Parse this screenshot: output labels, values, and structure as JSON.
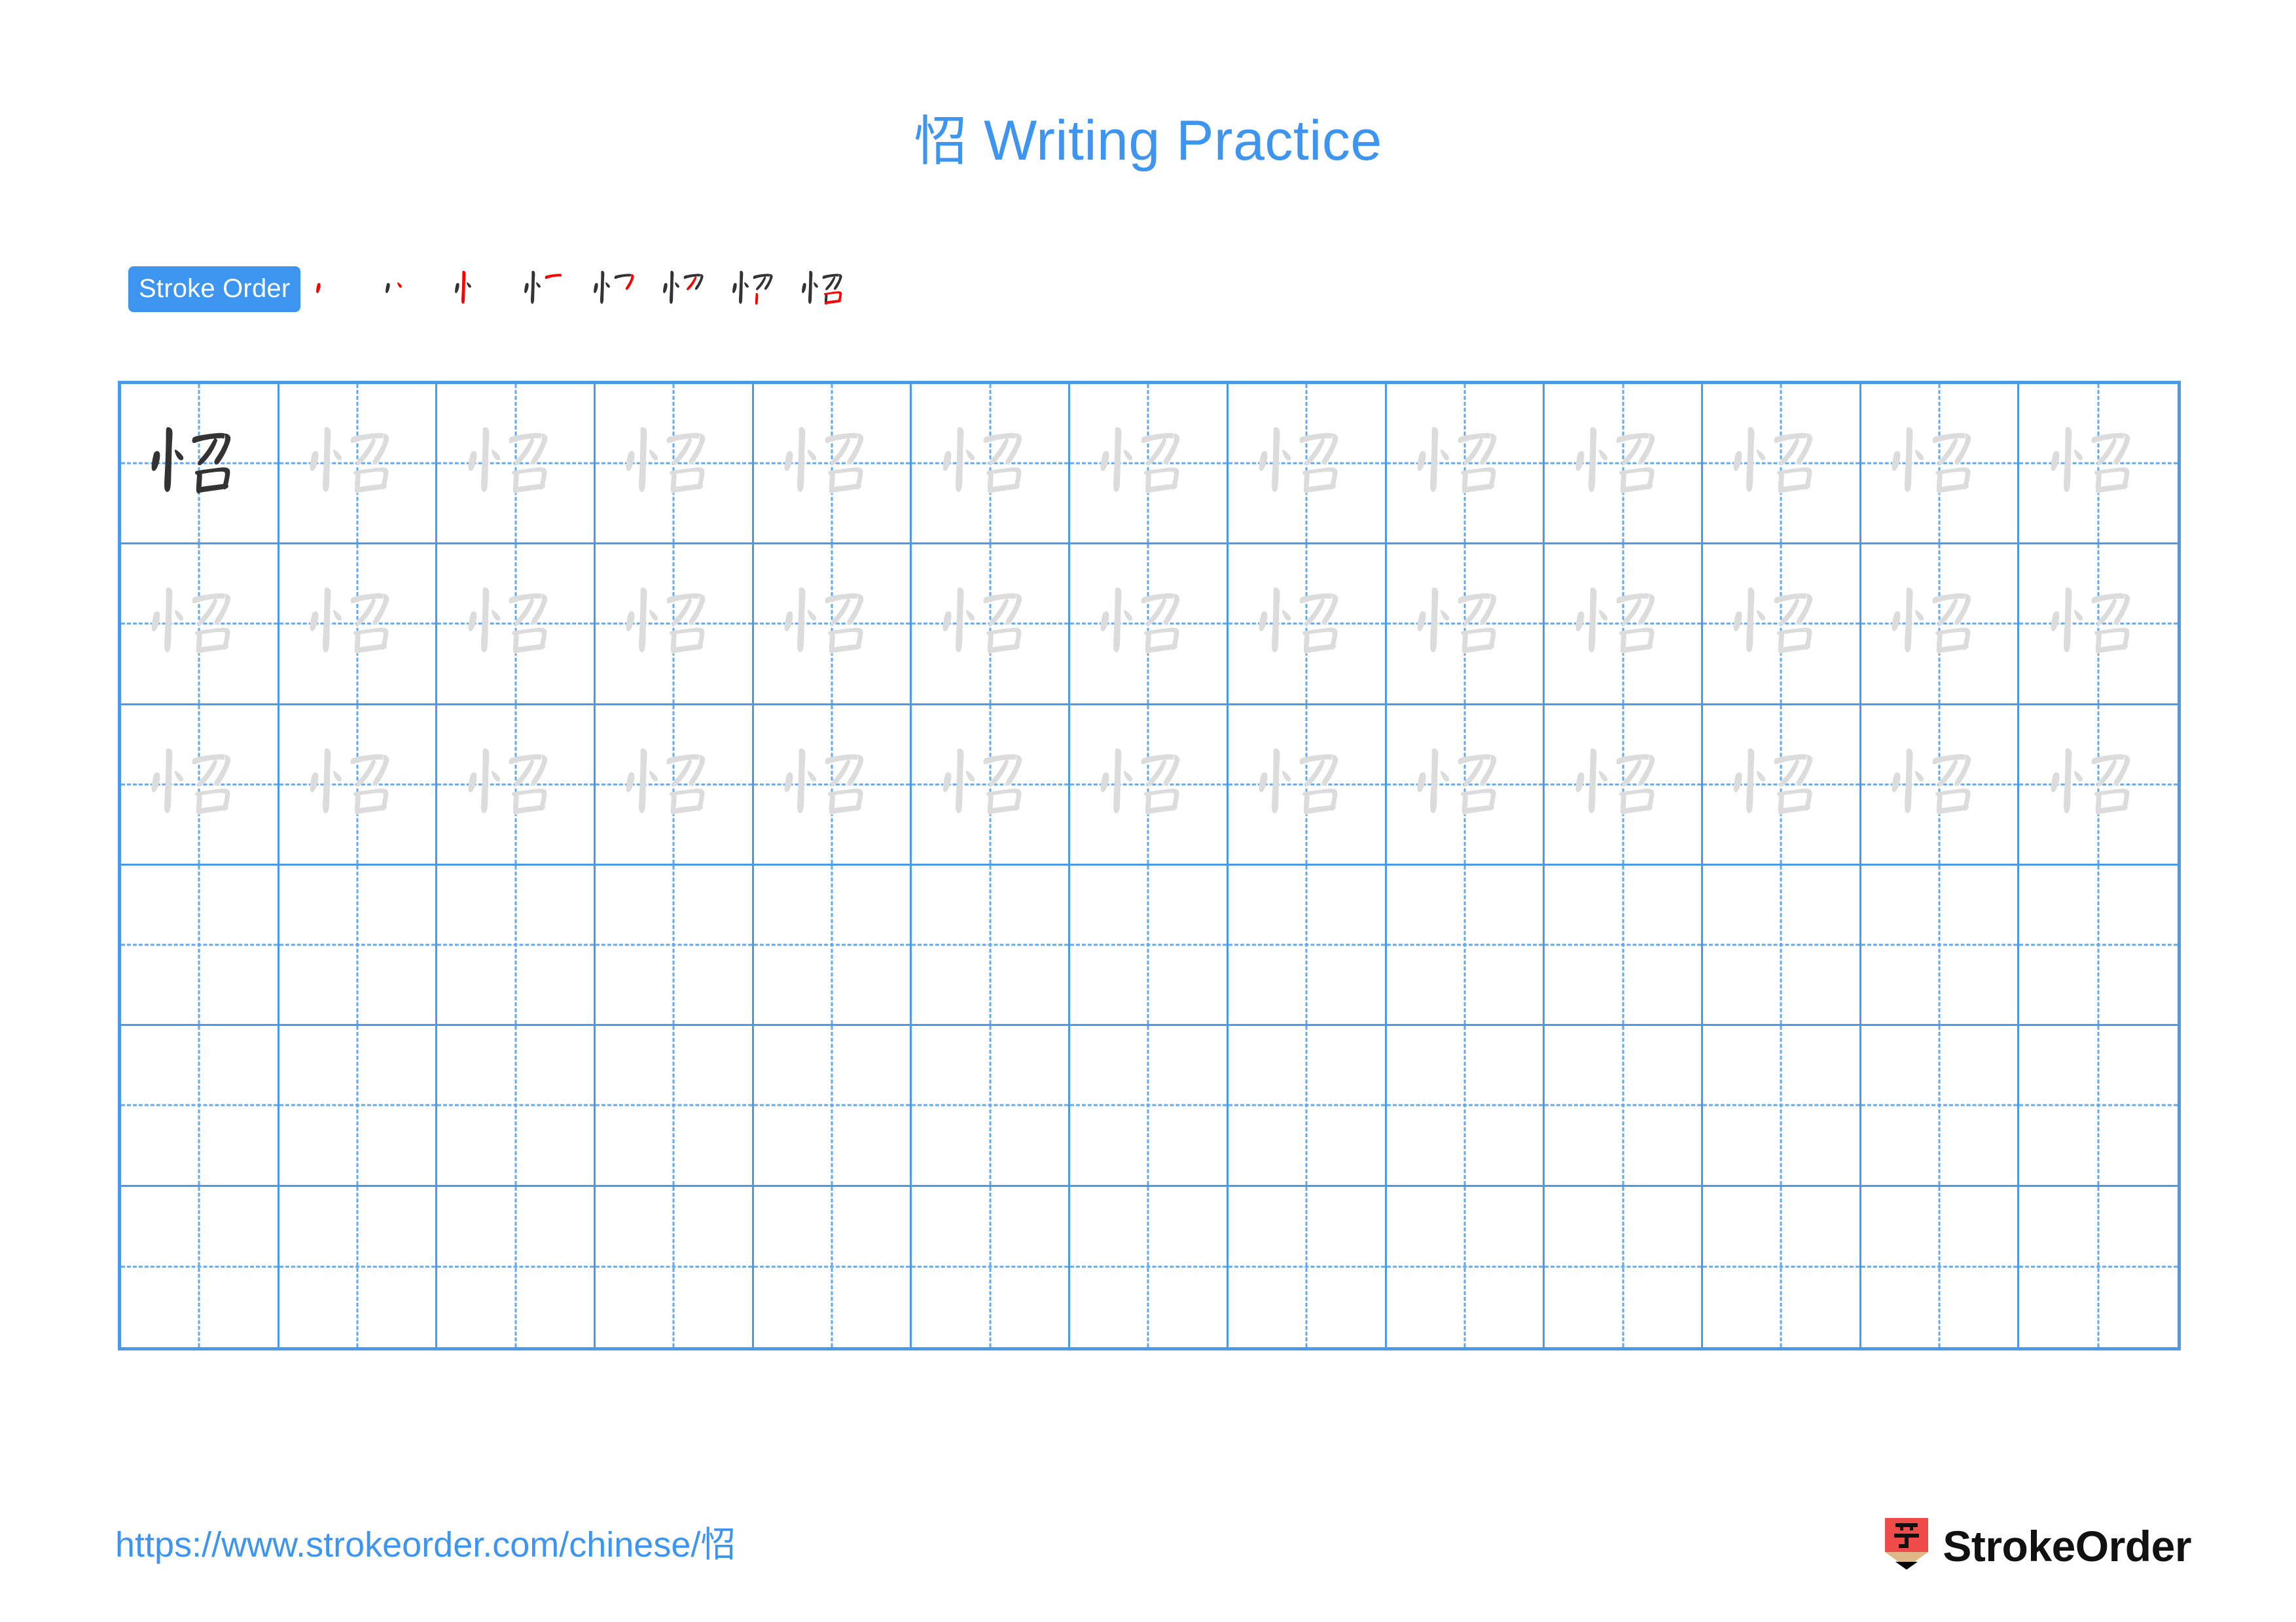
{
  "page": {
    "character": "怊",
    "title_suffix": " Writing Practice",
    "title_full": "怊 Writing Practice",
    "accent_color": "#3d95ef",
    "grid_line_color": "#4a9ae8",
    "guide_line_color": "#62a9ef",
    "trace_color": "#dcdcdc",
    "model_color": "#333333",
    "stroke_new_color": "#ff0000",
    "stroke_old_color": "#333333"
  },
  "stroke_order": {
    "badge_label": "Stroke Order",
    "stroke_count": 8,
    "steps": [
      {
        "index": 1,
        "strokes_shown": 1,
        "new_stroke": 1
      },
      {
        "index": 2,
        "strokes_shown": 2,
        "new_stroke": 2
      },
      {
        "index": 3,
        "strokes_shown": 3,
        "new_stroke": 3
      },
      {
        "index": 4,
        "strokes_shown": 4,
        "new_stroke": 4
      },
      {
        "index": 5,
        "strokes_shown": 5,
        "new_stroke": 5
      },
      {
        "index": 6,
        "strokes_shown": 6,
        "new_stroke": 6
      },
      {
        "index": 7,
        "strokes_shown": 7,
        "new_stroke": 7
      },
      {
        "index": 8,
        "strokes_shown": 8,
        "new_stroke": 8
      }
    ]
  },
  "practice_grid": {
    "columns": 13,
    "rows": 6,
    "rows_content": [
      {
        "row": 1,
        "first_cell": "model",
        "cells": [
          "model",
          "trace",
          "trace",
          "trace",
          "trace",
          "trace",
          "trace",
          "trace",
          "trace",
          "trace",
          "trace",
          "trace",
          "trace"
        ]
      },
      {
        "row": 2,
        "first_cell": "trace",
        "cells": [
          "trace",
          "trace",
          "trace",
          "trace",
          "trace",
          "trace",
          "trace",
          "trace",
          "trace",
          "trace",
          "trace",
          "trace",
          "trace"
        ]
      },
      {
        "row": 3,
        "first_cell": "trace",
        "cells": [
          "trace",
          "trace",
          "trace",
          "trace",
          "trace",
          "trace",
          "trace",
          "trace",
          "trace",
          "trace",
          "trace",
          "trace",
          "trace"
        ]
      },
      {
        "row": 4,
        "first_cell": "empty",
        "cells": [
          "empty",
          "empty",
          "empty",
          "empty",
          "empty",
          "empty",
          "empty",
          "empty",
          "empty",
          "empty",
          "empty",
          "empty",
          "empty"
        ]
      },
      {
        "row": 5,
        "first_cell": "empty",
        "cells": [
          "empty",
          "empty",
          "empty",
          "empty",
          "empty",
          "empty",
          "empty",
          "empty",
          "empty",
          "empty",
          "empty",
          "empty",
          "empty"
        ]
      },
      {
        "row": 6,
        "first_cell": "empty",
        "cells": [
          "empty",
          "empty",
          "empty",
          "empty",
          "empty",
          "empty",
          "empty",
          "empty",
          "empty",
          "empty",
          "empty",
          "empty",
          "empty"
        ]
      }
    ]
  },
  "footer": {
    "url": "https://www.strokeorder.com/chinese/怊",
    "brand_name": "StrokeOrder",
    "logo_character": "字",
    "logo_bg_color": "#ef4b4b",
    "logo_wood_color": "#deb887",
    "logo_tip_color": "#000000"
  }
}
